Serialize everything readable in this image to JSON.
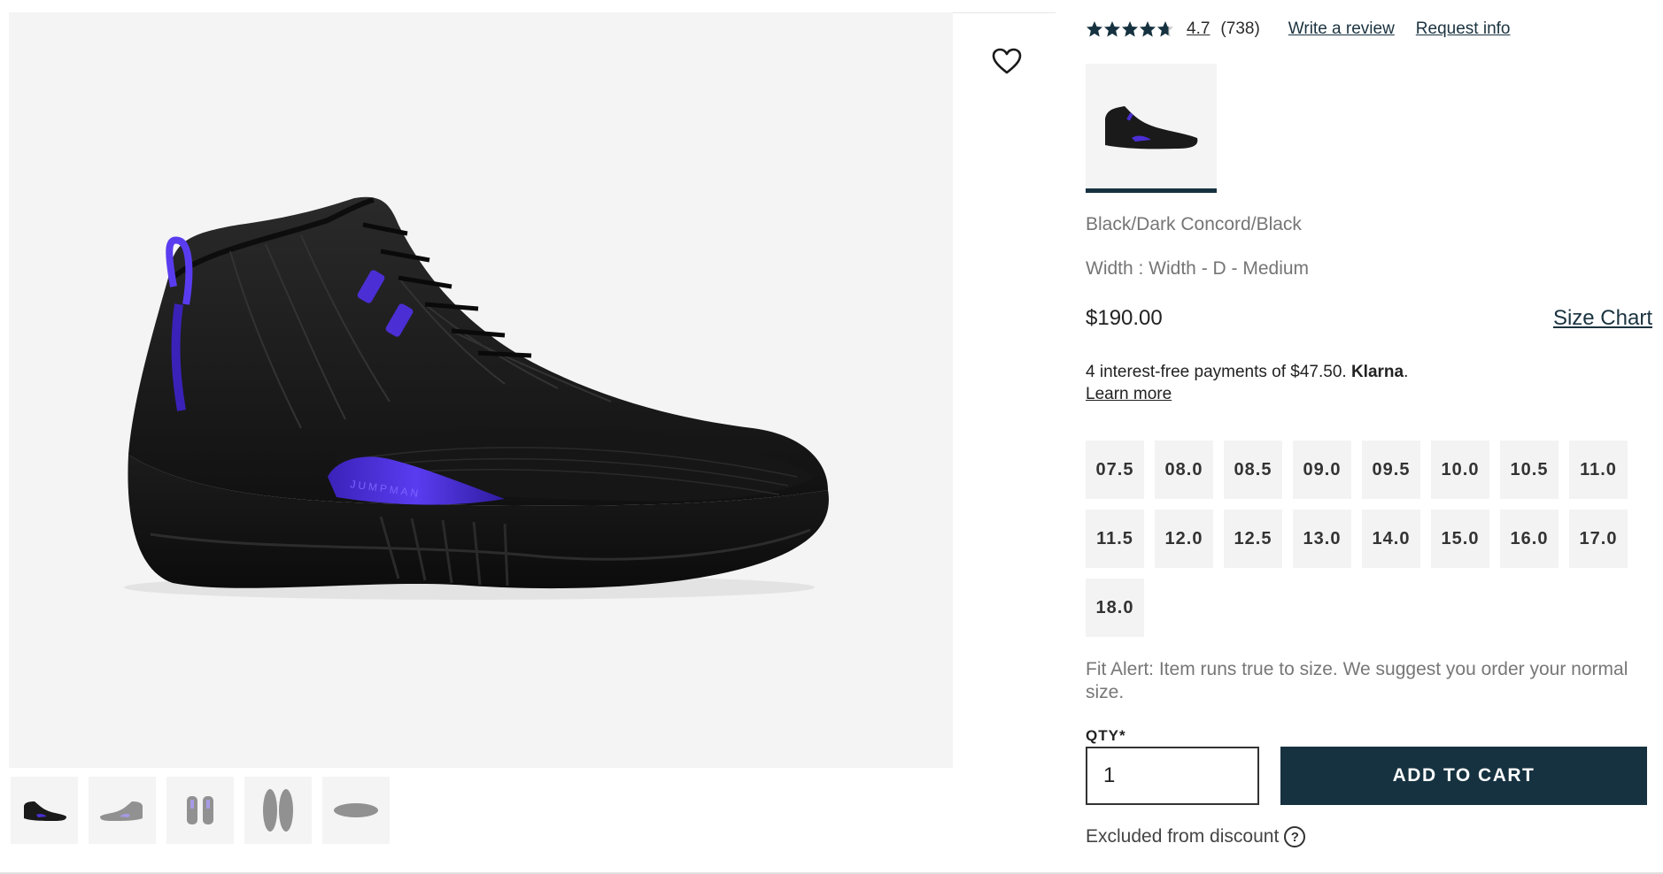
{
  "rating": {
    "stars": 4.7,
    "value": "4.7",
    "count": "(738)",
    "write_review": "Write a review",
    "request_info": "Request info"
  },
  "product": {
    "colorway": "Black/Dark Concord/Black",
    "width": "Width : Width - D - Medium",
    "price": "$190.00",
    "size_chart": "Size Chart"
  },
  "klarna": {
    "text": "4 interest-free payments of $47.50.",
    "brand": "Klarna",
    "period": ".",
    "learn_more": "Learn more"
  },
  "sizes": [
    "07.5",
    "08.0",
    "08.5",
    "09.0",
    "09.5",
    "10.0",
    "10.5",
    "11.0",
    "11.5",
    "12.0",
    "12.5",
    "13.0",
    "14.0",
    "15.0",
    "16.0",
    "17.0",
    "18.0"
  ],
  "fit_alert": "Fit Alert: Item runs true to size. We suggest you order your normal size.",
  "qty": {
    "label": "QTY*",
    "value": "1"
  },
  "cart": {
    "label": "ADD TO CART"
  },
  "discount": {
    "text": "Excluded from discount",
    "help": "?"
  },
  "colors": {
    "primary": "#163240",
    "accent_purple": "#4b2fd4",
    "image_bg": "#f4f4f4"
  },
  "icons": {
    "wishlist": "heart-outline-icon",
    "rating": "star-icon",
    "help": "question-circle-icon"
  }
}
